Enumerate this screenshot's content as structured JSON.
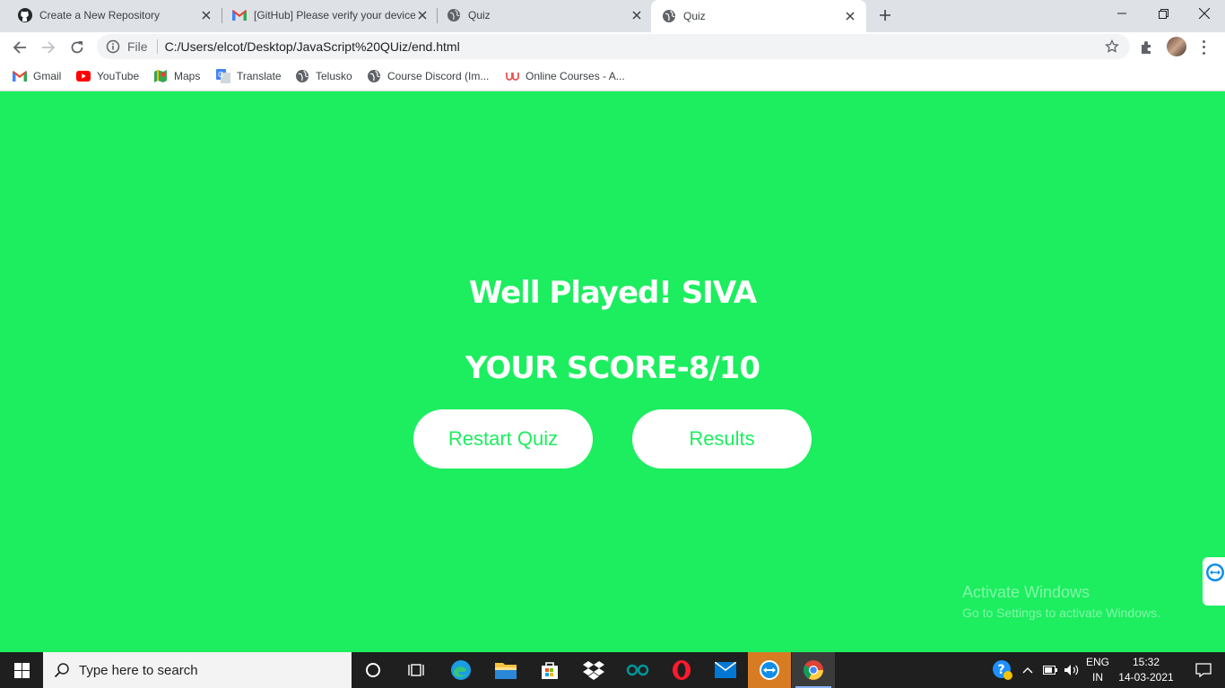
{
  "browser": {
    "tabs": [
      {
        "title": "Create a New Repository",
        "icon": "github-icon"
      },
      {
        "title": "[GitHub] Please verify your device",
        "icon": "gmail-icon"
      },
      {
        "title": "Quiz",
        "icon": "globe-icon"
      },
      {
        "title": "Quiz",
        "icon": "globe-icon",
        "active": true
      }
    ],
    "address": {
      "scheme_label": "File",
      "url": "C:/Users/elcot/Desktop/JavaScript%20QUiz/end.html"
    },
    "bookmarks": [
      {
        "label": "Gmail",
        "icon": "gmail-icon"
      },
      {
        "label": "YouTube",
        "icon": "youtube-icon"
      },
      {
        "label": "Maps",
        "icon": "maps-icon"
      },
      {
        "label": "Translate",
        "icon": "translate-icon"
      },
      {
        "label": "Telusko",
        "icon": "globe-icon"
      },
      {
        "label": "Course Discord (Im...",
        "icon": "globe-icon"
      },
      {
        "label": "Online Courses - A...",
        "icon": "udemy-icon"
      }
    ]
  },
  "page": {
    "greeting": "Well Played! SIVA",
    "score": "YOUR SCORE-8/10",
    "restart_label": "Restart Quiz",
    "results_label": "Results",
    "watermark_title": "Activate Windows",
    "watermark_sub": "Go to Settings to activate Windows.",
    "background_color": "#1cee5f"
  },
  "taskbar": {
    "search_placeholder": "Type here to search",
    "language_top": "ENG",
    "language_bottom": "IN",
    "time": "15:32",
    "date": "14-03-2021"
  }
}
